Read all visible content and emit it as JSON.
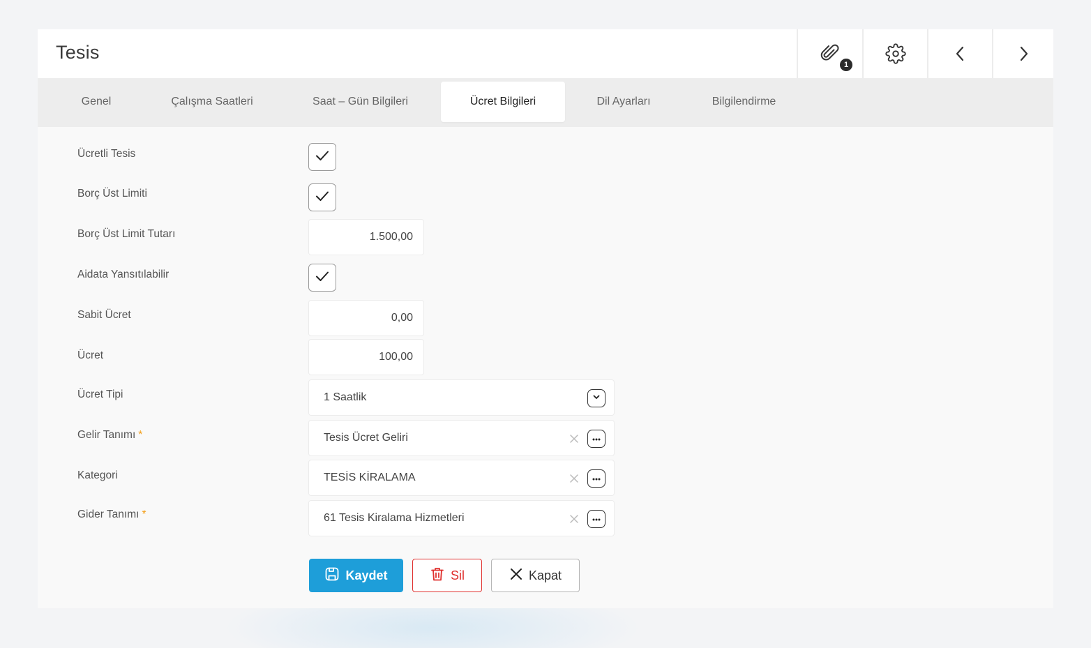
{
  "window": {
    "title": "Tesis"
  },
  "header": {
    "attachments_count": "1"
  },
  "tabs": [
    {
      "label": "Genel"
    },
    {
      "label": "Çalışma Saatleri"
    },
    {
      "label": "Saat – Gün Bilgileri"
    },
    {
      "label": "Ücret Bilgileri",
      "active": true
    },
    {
      "label": "Dil Ayarları"
    },
    {
      "label": "Bilgilendirme"
    }
  ],
  "form": {
    "ucretli_tesis": {
      "label": "Ücretli Tesis",
      "checked": true
    },
    "borc_ust_limiti": {
      "label": "Borç Üst Limiti",
      "checked": true
    },
    "borc_ust_limit_tutari": {
      "label": "Borç Üst Limit Tutarı",
      "value": "1.500,00"
    },
    "aidata_yansitilabilir": {
      "label": "Aidata Yansıtılabilir",
      "checked": true
    },
    "sabit_ucret": {
      "label": "Sabit Ücret",
      "value": "0,00"
    },
    "ucret": {
      "label": "Ücret",
      "value": "100,00"
    },
    "ucret_tipi": {
      "label": "Ücret Tipi",
      "value": "1 Saatlik"
    },
    "gelir_tanimi": {
      "label": "Gelir Tanımı",
      "required_mark": "*",
      "value": "Tesis Ücret Geliri"
    },
    "kategori": {
      "label": "Kategori",
      "value": "TESİS KİRALAMA"
    },
    "gider_tanimi": {
      "label": "Gider Tanımı",
      "required_mark": "*",
      "value": "61 Tesis Kiralama Hizmetleri"
    }
  },
  "actions": {
    "save": "Kaydet",
    "delete": "Sil",
    "close": "Kapat"
  },
  "colors": {
    "primary": "#1e9ed9",
    "danger": "#e0312f",
    "required": "#f39c12"
  }
}
